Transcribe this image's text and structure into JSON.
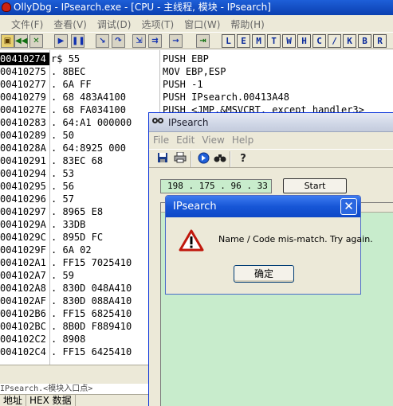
{
  "ollydbg": {
    "title": "OllyDbg - IPsearch.exe - [CPU - 主线程, 模块 - IPsearch]",
    "menu": [
      "文件(F)",
      "查看(V)",
      "调试(D)",
      "选项(T)",
      "窗口(W)",
      "帮助(H)"
    ],
    "toolbar_letters": [
      "L",
      "E",
      "M",
      "T",
      "W",
      "H",
      "C",
      "/",
      "K",
      "B",
      "R"
    ],
    "disasm_rows": [
      {
        "addr": "00410274",
        "marker": "r$",
        "hex": "55",
        "asm": "PUSH EBP"
      },
      {
        "addr": "00410275",
        "marker": ".",
        "hex": "8BEC",
        "asm": "MOV EBP,ESP"
      },
      {
        "addr": "00410277",
        "marker": ".",
        "hex": "6A FF",
        "asm": "PUSH -1"
      },
      {
        "addr": "00410279",
        "marker": ".",
        "hex": "68 483A4100",
        "asm": "PUSH IPsearch.00413A48"
      },
      {
        "addr": "0041027E",
        "marker": ".",
        "hex": "68 FA034100",
        "asm": "PUSH <JMP.&MSVCRT._except_handler3>"
      },
      {
        "addr": "00410283",
        "marker": ".",
        "hex": "64:A1 000000",
        "asm": ""
      },
      {
        "addr": "00410289",
        "marker": ".",
        "hex": "50",
        "asm": ""
      },
      {
        "addr": "0041028A",
        "marker": ".",
        "hex": "64:8925 000",
        "asm": ""
      },
      {
        "addr": "00410291",
        "marker": ".",
        "hex": "83EC 68",
        "asm": ""
      },
      {
        "addr": "00410294",
        "marker": ".",
        "hex": "53",
        "asm": ""
      },
      {
        "addr": "00410295",
        "marker": ".",
        "hex": "56",
        "asm": ""
      },
      {
        "addr": "00410296",
        "marker": ".",
        "hex": "57",
        "asm": ""
      },
      {
        "addr": "00410297",
        "marker": ".",
        "hex": "8965 E8",
        "asm": ""
      },
      {
        "addr": "0041029A",
        "marker": ".",
        "hex": "33DB",
        "asm": ""
      },
      {
        "addr": "0041029C",
        "marker": ".",
        "hex": "895D FC",
        "asm": ""
      },
      {
        "addr": "0041029F",
        "marker": ".",
        "hex": "6A 02",
        "asm": ""
      },
      {
        "addr": "004102A1",
        "marker": ".",
        "hex": "FF15 7025410",
        "asm": ""
      },
      {
        "addr": "004102A7",
        "marker": ".",
        "hex": "59",
        "asm": ""
      },
      {
        "addr": "004102A8",
        "marker": ".",
        "hex": "830D 048A410",
        "asm": ""
      },
      {
        "addr": "004102AF",
        "marker": ".",
        "hex": "830D 088A410",
        "asm": ""
      },
      {
        "addr": "004102B6",
        "marker": ".",
        "hex": "FF15 6825410",
        "asm": ""
      },
      {
        "addr": "004102BC",
        "marker": ".",
        "hex": "8B0D F889410",
        "asm": ""
      },
      {
        "addr": "004102C2",
        "marker": ".",
        "hex": "8908",
        "asm": ""
      },
      {
        "addr": "004102C4",
        "marker": ".",
        "hex": "FF15 6425410",
        "asm": ""
      }
    ],
    "status": "IPsearch.<模块入口点>",
    "dump_headers": [
      "地址",
      "HEX 数据"
    ]
  },
  "ipsearch": {
    "title": "IPsearch",
    "menu": [
      "File",
      "Edit",
      "View",
      "Help"
    ],
    "ip_value": "198 . 175 . 96 . 33",
    "start_label": "Start"
  },
  "msgbox": {
    "title": "IPsearch",
    "close_label": "✕",
    "message": "Name / Code mis-match. Try again.",
    "ok_label": "确定"
  }
}
